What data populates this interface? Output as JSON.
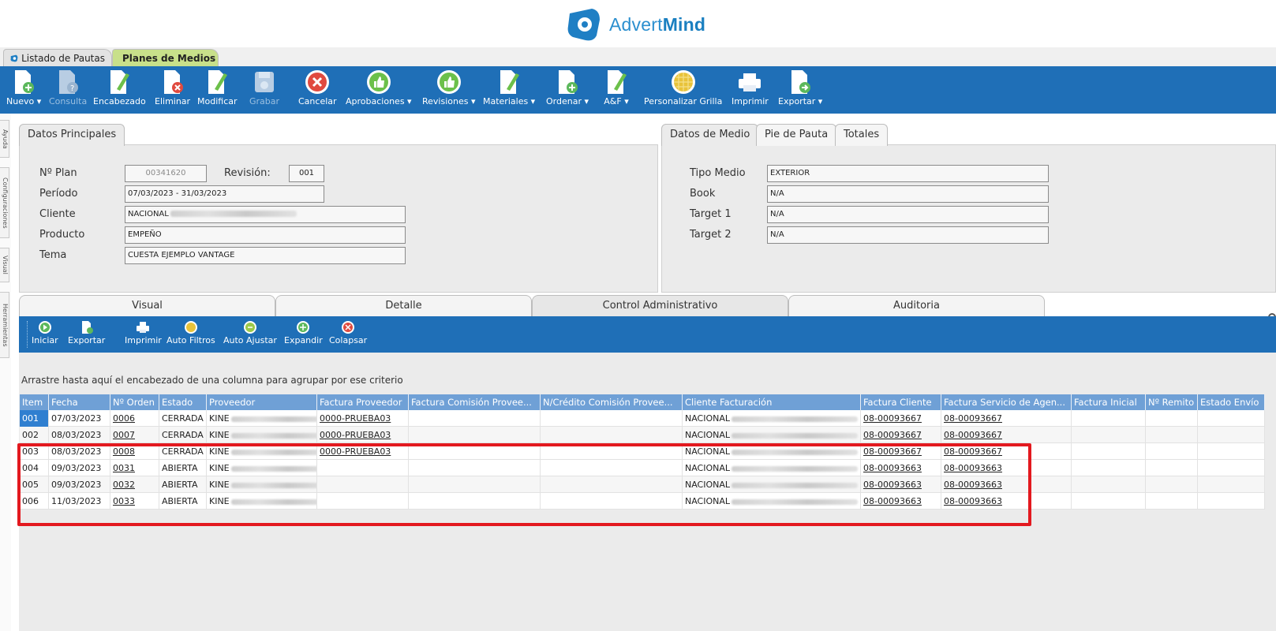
{
  "brand": {
    "name_light": "Advert",
    "name_bold": "Mind",
    "color": "#2b8fcf"
  },
  "top_tabs": [
    {
      "label": "Listado de Pautas"
    },
    {
      "label": "Planes de Medios"
    }
  ],
  "toolbar": {
    "buttons": [
      {
        "label": "Nuevo ▾",
        "icon": "new-document-icon"
      },
      {
        "label": "Consulta",
        "icon": "query-document-icon",
        "disabled": true
      },
      {
        "label": "Encabezado",
        "icon": "edit-header-icon"
      },
      {
        "label": "Eliminar",
        "icon": "delete-document-icon"
      },
      {
        "label": "Modificar",
        "icon": "edit-document-icon"
      },
      {
        "label": "Grabar",
        "icon": "save-disk-icon",
        "disabled": true
      },
      {
        "label": "Cancelar",
        "icon": "cancel-icon"
      },
      {
        "label": "Aprobaciones ▾",
        "icon": "thumbs-up-icon"
      },
      {
        "label": "Revisiones ▾",
        "icon": "thumbs-up-icon"
      },
      {
        "label": "Materiales ▾",
        "icon": "edit-document-icon"
      },
      {
        "label": "Ordenar ▾",
        "icon": "new-document-icon"
      },
      {
        "label": "A&F ▾",
        "icon": "edit-document-icon"
      },
      {
        "label": "Personalizar Grilla",
        "icon": "grid-globe-icon"
      },
      {
        "label": "Imprimir",
        "icon": "printer-icon"
      },
      {
        "label": "Exportar ▾",
        "icon": "export-document-icon"
      }
    ]
  },
  "left_rail": [
    "Ayuda",
    "Configuraciones",
    "Visual",
    "Herramientas"
  ],
  "datos_principales": {
    "tab_label": "Datos Principales",
    "plan_label": "Nº Plan",
    "plan_value": "00341620",
    "revision_label": "Revisión:",
    "revision_value": "001",
    "periodo_label": "Período",
    "periodo_value": "07/03/2023 - 31/03/2023",
    "cliente_label": "Cliente",
    "cliente_value": "NACIONAL",
    "producto_label": "Producto",
    "producto_value": "EMPEÑO",
    "tema_label": "Tema",
    "tema_value": "CUESTA EJEMPLO VANTAGE"
  },
  "datos_medio": {
    "tabs": [
      "Datos de Medio",
      "Pie de Pauta",
      "Totales"
    ],
    "tipo_medio_label": "Tipo Medio",
    "tipo_medio_value": "EXTERIOR",
    "book_label": "Book",
    "book_value": "N/A",
    "target1_label": "Target 1",
    "target1_value": "N/A",
    "target2_label": "Target 2",
    "target2_value": "N/A"
  },
  "mid_tabs": [
    "Visual",
    "Detalle",
    "Control Administrativo",
    "Auditoria"
  ],
  "sub_toolbar": {
    "buttons": [
      {
        "label": "Iniciar",
        "icon": "play-icon"
      },
      {
        "label": "Exportar",
        "icon": "export-icon"
      },
      {
        "label": "Imprimir",
        "icon": "printer-icon"
      },
      {
        "label": "Auto Filtros",
        "icon": "filter-icon"
      },
      {
        "label": "Auto Ajustar",
        "icon": "auto-fit-icon"
      },
      {
        "label": "Expandir",
        "icon": "expand-icon"
      },
      {
        "label": "Colapsar",
        "icon": "collapse-icon"
      }
    ]
  },
  "grid": {
    "group_hint": "Arrastre hasta aquí el encabezado de una columna para agrupar por ese criterio",
    "columns": [
      "Item",
      "Fecha",
      "Nº Orden",
      "Estado",
      "Proveedor",
      "Factura Proveedor",
      "Factura Comisión Provee...",
      "N/Crédito Comisión Provee...",
      "Cliente Facturación",
      "Factura Cliente",
      "Factura Servicio de Agen...",
      "Factura Inicial",
      "Nº Remito",
      "Estado Envío"
    ],
    "rows": [
      {
        "item": "001",
        "fecha": "07/03/2023",
        "orden": "0006",
        "estado": "CERRADA",
        "proveedor": "KINE",
        "factura_proveedor": "0000-PRUEBA03",
        "cliente_fact": "NACIONAL",
        "factura_cliente": "08-00093667",
        "factura_servicio": "08-00093667"
      },
      {
        "item": "002",
        "fecha": "08/03/2023",
        "orden": "0007",
        "estado": "CERRADA",
        "proveedor": "KINE",
        "factura_proveedor": "0000-PRUEBA03",
        "cliente_fact": "NACIONAL",
        "factura_cliente": "08-00093667",
        "factura_servicio": "08-00093667"
      },
      {
        "item": "003",
        "fecha": "08/03/2023",
        "orden": "0008",
        "estado": "CERRADA",
        "proveedor": "KINE",
        "factura_proveedor": "0000-PRUEBA03",
        "cliente_fact": "NACIONAL",
        "factura_cliente": "08-00093667",
        "factura_servicio": "08-00093667"
      },
      {
        "item": "004",
        "fecha": "09/03/2023",
        "orden": "0031",
        "estado": "ABIERTA",
        "proveedor": "KINE",
        "factura_proveedor": "",
        "cliente_fact": "NACIONAL",
        "factura_cliente": "08-00093663",
        "factura_servicio": "08-00093663"
      },
      {
        "item": "005",
        "fecha": "09/03/2023",
        "orden": "0032",
        "estado": "ABIERTA",
        "proveedor": "KINE",
        "factura_proveedor": "",
        "cliente_fact": "NACIONAL",
        "factura_cliente": "08-00093663",
        "factura_servicio": "08-00093663"
      },
      {
        "item": "006",
        "fecha": "11/03/2023",
        "orden": "0033",
        "estado": "ABIERTA",
        "proveedor": "KINE",
        "factura_proveedor": "",
        "cliente_fact": "NACIONAL",
        "factura_cliente": "08-00093663",
        "factura_servicio": "08-00093663"
      }
    ]
  },
  "colors": {
    "toolbar_blue": "#1f6fb7",
    "header_blue": "#6fa0d6",
    "highlight_red": "#e3191f",
    "selected_tab_green": "#c8e08a"
  }
}
